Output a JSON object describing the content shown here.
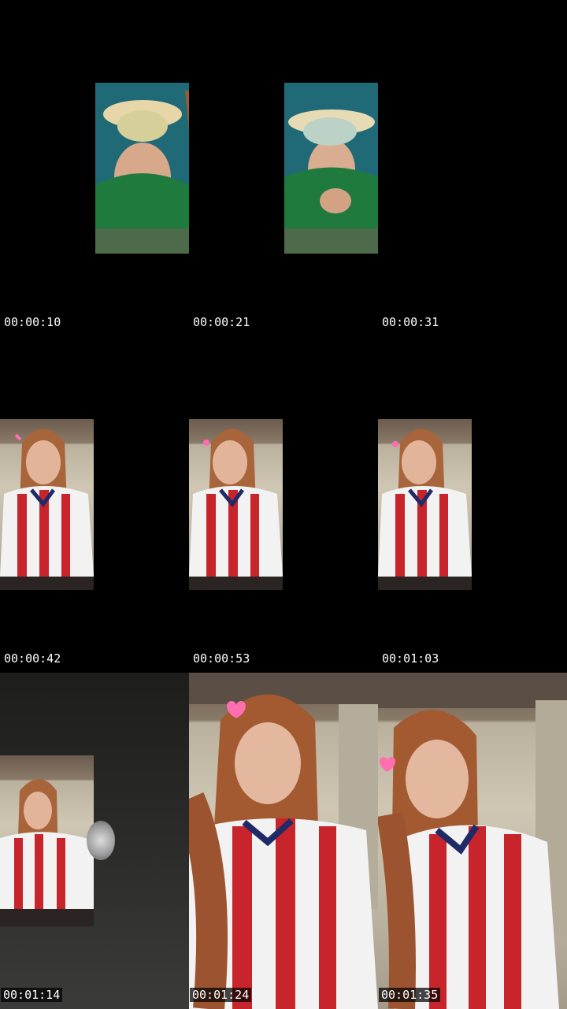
{
  "frames": [
    {
      "timestamp": "00:00:10"
    },
    {
      "timestamp": "00:00:21"
    },
    {
      "timestamp": "00:00:31"
    },
    {
      "timestamp": "00:00:42"
    },
    {
      "timestamp": "00:00:53"
    },
    {
      "timestamp": "00:01:03"
    },
    {
      "timestamp": "00:01:14"
    },
    {
      "timestamp": "00:01:24"
    },
    {
      "timestamp": "00:01:35"
    }
  ],
  "colors": {
    "background": "#000000",
    "timestamp_text": "#ffffff",
    "jersey_red": "#c8242b",
    "jersey_white": "#f2f2f2",
    "jersey_navy": "#1f2a66",
    "heart_pink": "#ff6fb0"
  }
}
